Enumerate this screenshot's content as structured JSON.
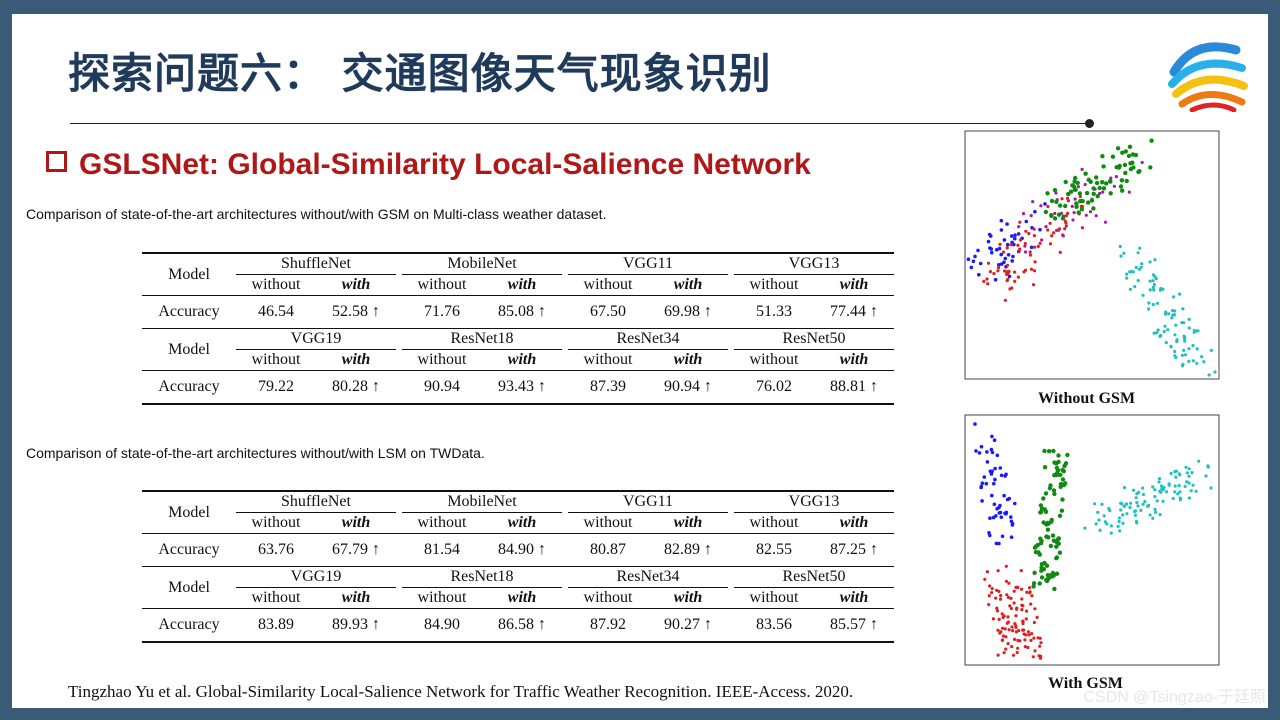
{
  "title": "探索问题六：  交通图像天气现象识别",
  "subtitle": "GSLSNet: Global-Similarity Local-Salience Network",
  "table1": {
    "caption": "Comparison of state-of-the-art architectures without/with GSM on Multi-class weather dataset.",
    "model_label": "Model",
    "accuracy_label": "Accuracy",
    "without_label": "without",
    "with_label": "with",
    "blocks": [
      {
        "archs": [
          "ShuffleNet",
          "MobileNet",
          "VGG11",
          "VGG13"
        ],
        "values": [
          "46.54",
          "52.58 ↑",
          "71.76",
          "85.08 ↑",
          "67.50",
          "69.98 ↑",
          "51.33",
          "77.44 ↑"
        ]
      },
      {
        "archs": [
          "VGG19",
          "ResNet18",
          "ResNet34",
          "ResNet50"
        ],
        "values": [
          "79.22",
          "80.28 ↑",
          "90.94",
          "93.43 ↑",
          "87.39",
          "90.94 ↑",
          "76.02",
          "88.81 ↑"
        ]
      }
    ]
  },
  "table2": {
    "caption": "Comparison of state-of-the-art architectures without/with LSM on TWData.",
    "model_label": "Model",
    "accuracy_label": "Accuracy",
    "without_label": "without",
    "with_label": "with",
    "blocks": [
      {
        "archs": [
          "ShuffleNet",
          "MobileNet",
          "VGG11",
          "VGG13"
        ],
        "values": [
          "63.76",
          "67.79 ↑",
          "81.54",
          "84.90 ↑",
          "80.87",
          "82.89 ↑",
          "82.55",
          "87.25 ↑"
        ]
      },
      {
        "archs": [
          "VGG19",
          "ResNet18",
          "ResNet34",
          "ResNet50"
        ],
        "values": [
          "83.89",
          "89.93 ↑",
          "84.90",
          "86.58 ↑",
          "87.92",
          "90.27 ↑",
          "83.56",
          "85.57 ↑"
        ]
      }
    ]
  },
  "scatter_top_label": "Without GSM",
  "scatter_bottom_label": "With GSM",
  "reference": "Tingzhao  Yu et al. Global-Similarity Local-Salience Network for Traffic Weather Recognition. IEEE-Access. 2020.",
  "watermark": "CSDN @Tsingzao-于廷照",
  "colors": {
    "title": "#1f3a5a",
    "subtitle": "#b01818",
    "frame": "#3a5a78",
    "cluster_blue": "#1a1aff",
    "cluster_red": "#e02020",
    "cluster_green": "#108a10",
    "cluster_cyan": "#20c0c0",
    "cluster_purple": "#a020a0"
  }
}
